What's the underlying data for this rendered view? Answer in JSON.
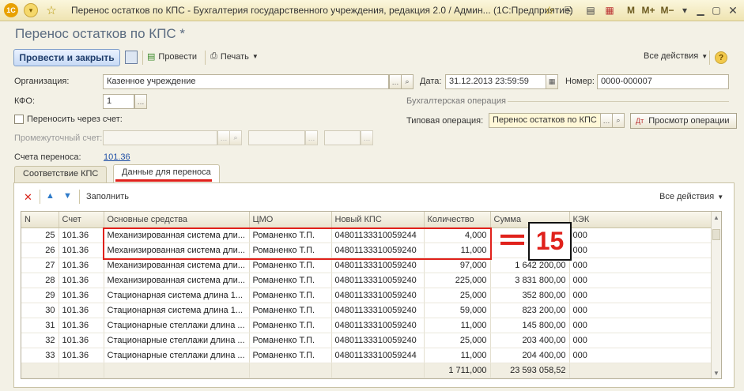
{
  "window": {
    "title": "Перенос остатков по КПС - Бухгалтерия государственного учреждения, редакция 2.0 / Админ...   (1С:Предприятие)",
    "m_buttons": [
      "M",
      "M+",
      "M−"
    ]
  },
  "form": {
    "title": "Перенос остатков по КПС *",
    "post_close": "Провести и закрыть",
    "post": "Провести",
    "print": "Печать",
    "all_actions": "Все действия",
    "help": "?"
  },
  "fields": {
    "org_label": "Организация:",
    "org_value": "Казенное учреждение",
    "date_label": "Дата:",
    "date_value": "31.12.2013 23:59:59",
    "number_label": "Номер:",
    "number_value": "0000-000007",
    "kfo_label": "КФО:",
    "kfo_value": "1",
    "transfer_via_label": "Переносить через счет:",
    "intermediate_label": "Промежуточный счет:",
    "accounts_label": "Счета переноса:",
    "accounts_value": "101.36",
    "accounting_op_group": "Бухгалтерская операция",
    "typical_op_label": "Типовая операция:",
    "typical_op_value": "Перенос остатков по КПС",
    "view_ops": "Просмотр операции"
  },
  "tabs": [
    {
      "label": "Соответствие КПС"
    },
    {
      "label": "Данные для переноса"
    }
  ],
  "table_toolbar": {
    "fill": "Заполнить",
    "all_actions": "Все действия"
  },
  "table": {
    "columns": [
      "N",
      "Счет",
      "Основные средства",
      "ЦМО",
      "Новый КПС",
      "Количество",
      "Сумма",
      "КЭК"
    ],
    "rows": [
      [
        "25",
        "101.36",
        "Механизированная система дли...",
        "Романенко Т.П.",
        "04801133310059244",
        "4,000",
        "",
        "000"
      ],
      [
        "26",
        "101.36",
        "Механизированная система дли...",
        "Романенко Т.П.",
        "04801133310059240",
        "11,000",
        "",
        "000"
      ],
      [
        "27",
        "101.36",
        "Механизированная система дли...",
        "Романенко Т.П.",
        "04801133310059240",
        "97,000",
        "1 642 200,00",
        "000"
      ],
      [
        "28",
        "101.36",
        "Механизированная система дли...",
        "Романенко Т.П.",
        "04801133310059240",
        "225,000",
        "3 831 800,00",
        "000"
      ],
      [
        "29",
        "101.36",
        "Стационарная  система длина 1...",
        "Романенко Т.П.",
        "04801133310059240",
        "25,000",
        "352 800,00",
        "000"
      ],
      [
        "30",
        "101.36",
        "Стационарная  система длина 1...",
        "Романенко Т.П.",
        "04801133310059240",
        "59,000",
        "823 200,00",
        "000"
      ],
      [
        "31",
        "101.36",
        "Стационарные стеллажи длина ...",
        "Романенко Т.П.",
        "04801133310059240",
        "11,000",
        "145 800,00",
        "000"
      ],
      [
        "32",
        "101.36",
        "Стационарные стеллажи длина ...",
        "Романенко Т.П.",
        "04801133310059240",
        "25,000",
        "203 400,00",
        "000"
      ],
      [
        "33",
        "101.36",
        "Стационарные стеллажи длина ...",
        "Романенко Т.П.",
        "04801133310059244",
        "11,000",
        "204 400,00",
        "000"
      ]
    ],
    "total_quantity": "1 711,000",
    "total_sum": "23 593 058,52"
  },
  "annotation": {
    "number": "15"
  }
}
